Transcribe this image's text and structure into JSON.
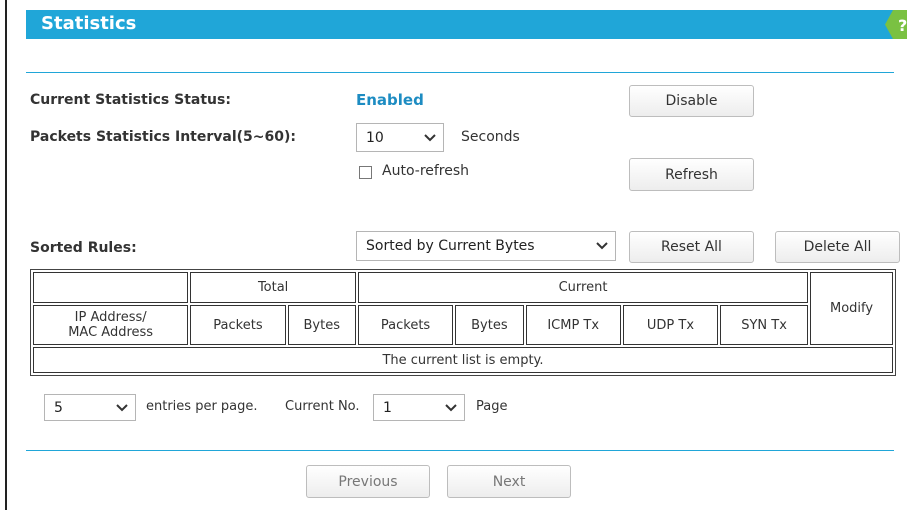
{
  "header": {
    "title": "Statistics",
    "help_glyph": "?"
  },
  "status": {
    "label": "Current Statistics Status:",
    "value": "Enabled",
    "disable_button": "Disable"
  },
  "interval": {
    "label": "Packets Statistics Interval(5~60):",
    "selected": "10",
    "unit": "Seconds"
  },
  "auto_refresh": {
    "label": "Auto-refresh",
    "checked": false
  },
  "refresh_button": "Refresh",
  "sorted_rules": {
    "label": "Sorted Rules:",
    "selected": "Sorted by Current Bytes",
    "reset_all": "Reset All",
    "delete_all": "Delete All"
  },
  "table": {
    "group_total": "Total",
    "group_current": "Current",
    "modify": "Modify",
    "ip_mac_line1": "IP Address/",
    "ip_mac_line2": "MAC Address",
    "columns": [
      "Packets",
      "Bytes",
      "Packets",
      "Bytes",
      "ICMP Tx",
      "UDP Tx",
      "SYN Tx"
    ],
    "empty_message": "The current list is empty."
  },
  "pagination": {
    "entries_value": "5",
    "entries_label": "entries per page.",
    "current_no_label": "Current No.",
    "current_no_value": "1",
    "page_label": "Page",
    "previous": "Previous",
    "next": "Next"
  },
  "colors": {
    "accent": "#20a6d8",
    "help_green": "#7ac142",
    "status_blue": "#1d8cc2"
  }
}
